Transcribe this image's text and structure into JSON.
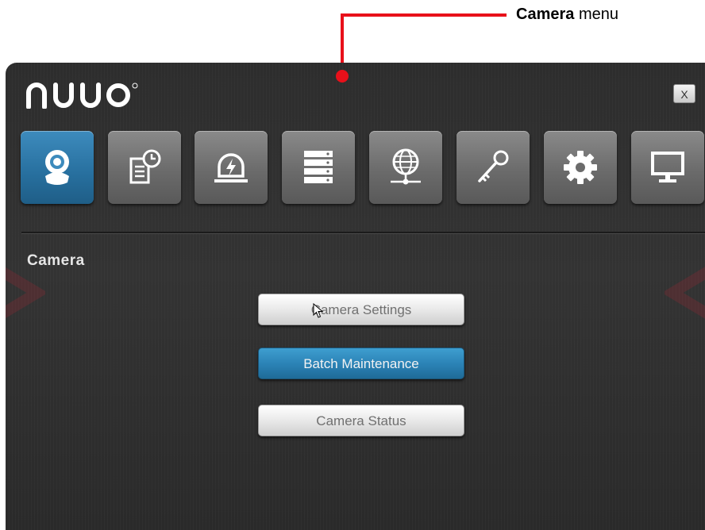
{
  "callout": {
    "bold": "Camera",
    "rest": " menu"
  },
  "window": {
    "close_label": "X"
  },
  "toolbar": {
    "items": [
      {
        "name": "camera",
        "icon": "webcam-icon",
        "active": true
      },
      {
        "name": "schedule",
        "icon": "schedule-document-icon",
        "active": false
      },
      {
        "name": "event",
        "icon": "alarm-lightning-icon",
        "active": false
      },
      {
        "name": "storage",
        "icon": "server-stack-icon",
        "active": false
      },
      {
        "name": "network",
        "icon": "globe-network-icon",
        "active": false
      },
      {
        "name": "security",
        "icon": "key-icon",
        "active": false
      },
      {
        "name": "system",
        "icon": "gear-icon",
        "active": false
      },
      {
        "name": "display",
        "icon": "monitor-icon",
        "active": false
      }
    ]
  },
  "section": {
    "title": "Camera"
  },
  "menu": {
    "camera_settings": "Camera Settings",
    "batch_maintenance": "Batch Maintenance",
    "camera_status": "Camera Status"
  },
  "colors": {
    "accent": "#2a81b4",
    "callout": "#e8101a"
  }
}
